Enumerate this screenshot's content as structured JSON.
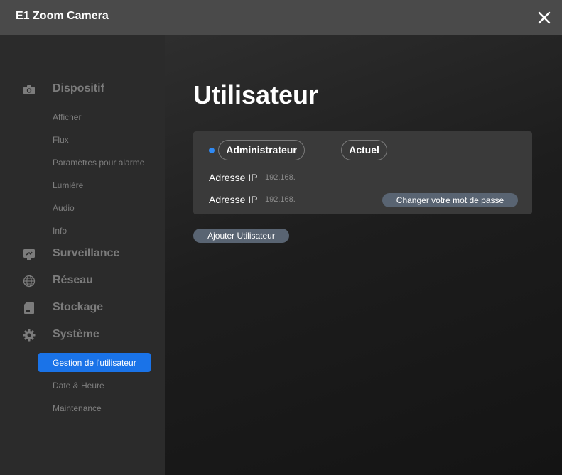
{
  "window": {
    "title": "E1 Zoom Camera"
  },
  "sidebar": {
    "dispositif": {
      "label": "Dispositif",
      "icon": "camera-icon",
      "items": [
        "Afficher",
        "Flux",
        "Paramètres pour alarme",
        "Lumière",
        "Audio",
        "Info"
      ]
    },
    "surveillance": {
      "label": "Surveillance",
      "icon": "monitor-icon"
    },
    "reseau": {
      "label": "Réseau",
      "icon": "globe-icon"
    },
    "stockage": {
      "label": "Stockage",
      "icon": "sd-card-icon"
    },
    "systeme": {
      "label": "Système",
      "icon": "gear-icon",
      "items": [
        "Gestion de l'utilisateur",
        "Date & Heure",
        "Maintenance"
      ],
      "active_item": "Gestion de l'utilisateur"
    }
  },
  "main": {
    "title": "Utilisateur",
    "user_card": {
      "username": "Administrateur",
      "status": "Actuel",
      "ip_rows": [
        {
          "label": "Adresse IP",
          "value": "192.168."
        },
        {
          "label": "Adresse IP",
          "value": "192.168."
        }
      ],
      "change_password_label": "Changer votre mot de passe"
    },
    "add_user_label": "Ajouter Utilisateur"
  },
  "colors": {
    "accent": "#1a73e8",
    "online_dot": "#2f8af5",
    "button_bg": "#596472",
    "titlebar_bg": "#4a4a4a",
    "sidebar_bg": "#2b2b2b"
  }
}
